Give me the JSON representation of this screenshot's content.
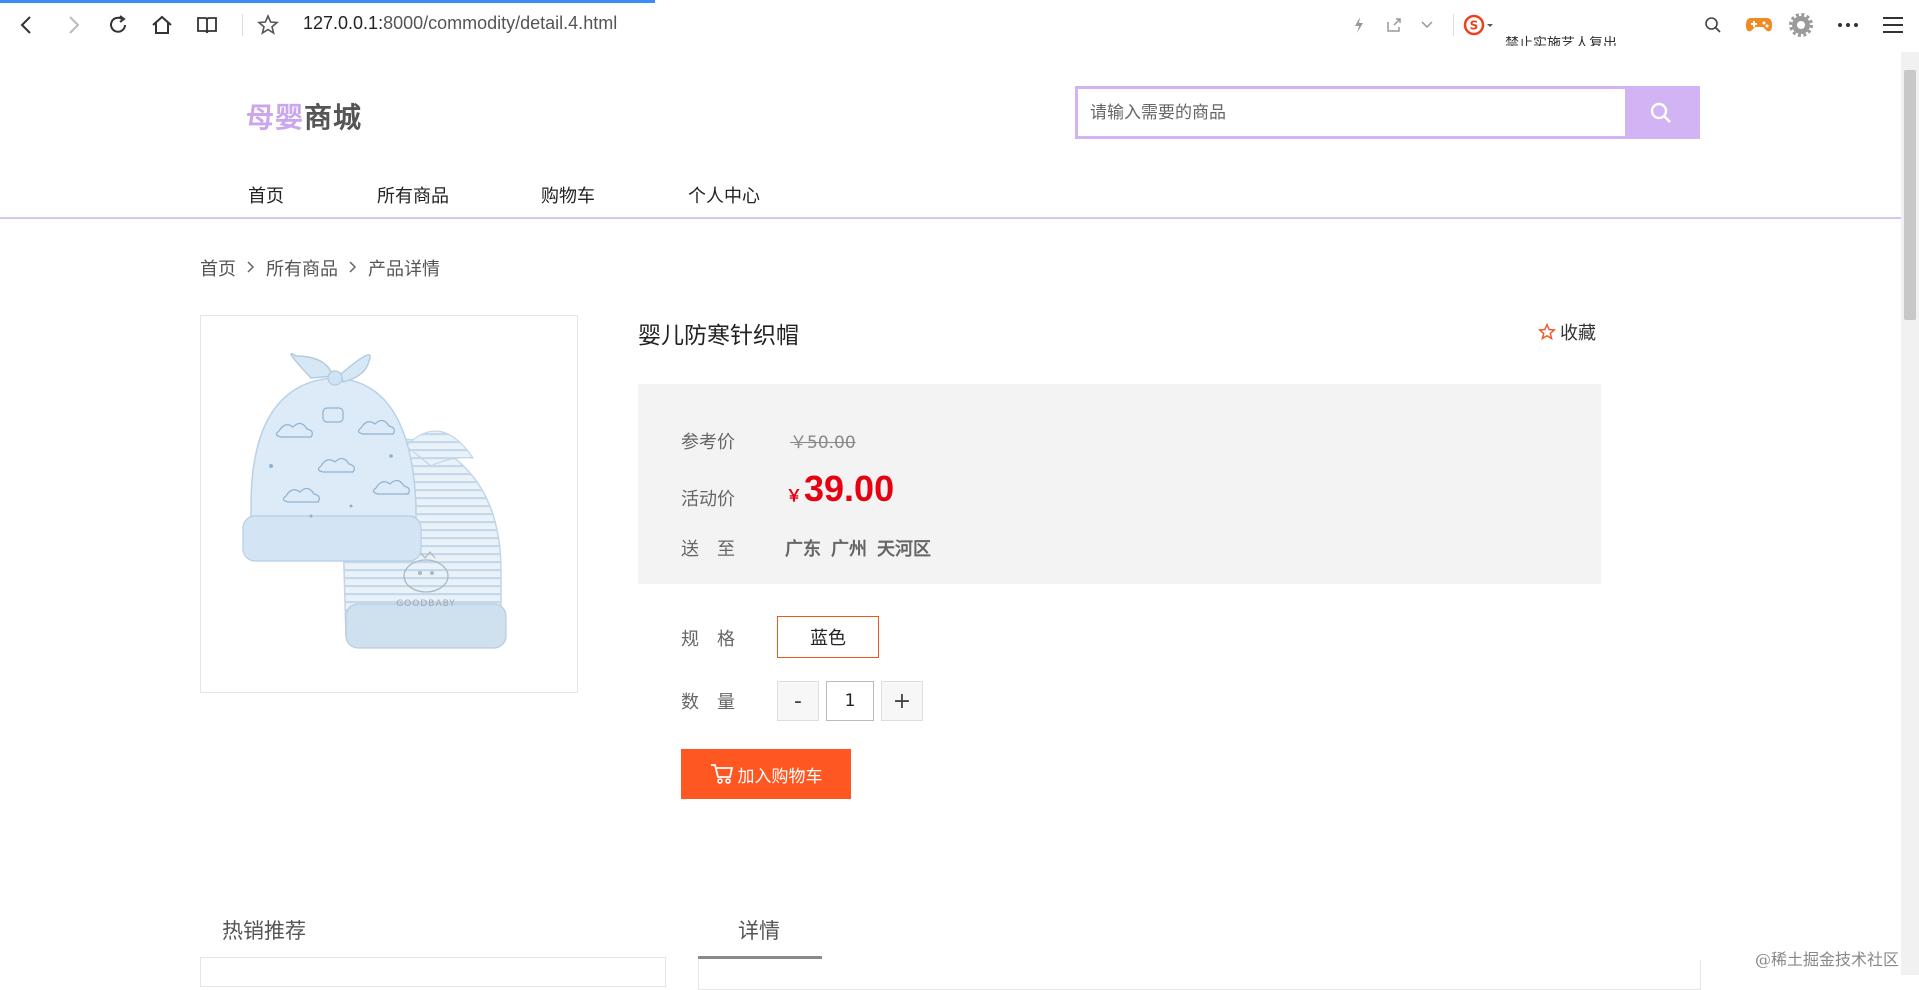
{
  "browser": {
    "url_host": "127.0.0.1:",
    "url_path": "8000/commodity/detail.4.html",
    "marquee_text": "禁止实施艺人复出"
  },
  "site": {
    "logo_prefix": "母婴",
    "logo_suffix": "商城",
    "search_placeholder": "请输入需要的商品",
    "nav": [
      "首页",
      "所有商品",
      "购物车",
      "个人中心"
    ]
  },
  "breadcrumb": [
    "首页",
    "所有商品",
    "产品详情"
  ],
  "product": {
    "title": "婴儿防寒针织帽",
    "favorite_label": "收藏",
    "ref_price_label": "参考价",
    "ref_price": "￥50.00",
    "act_price_label": "活动价",
    "currency": "￥",
    "act_price": "39.00",
    "ship_label": "送　至",
    "region": [
      "广东",
      "广州",
      "天河区"
    ],
    "spec_label": "规　格",
    "spec_value": "蓝色",
    "qty_label": "数　量",
    "qty_minus": "-",
    "qty_plus": "+",
    "qty_value": "1",
    "add_cart_label": "加入购物车",
    "image_caption": "GOODBABY"
  },
  "bottom": {
    "hot_title": "热销推荐",
    "detail_tab": "详情"
  },
  "watermark": "@稀土掘金技术社区",
  "colors": {
    "accent_purple": "#d2b4f4",
    "price_red": "#e60012",
    "cart_orange": "#ff5722"
  }
}
